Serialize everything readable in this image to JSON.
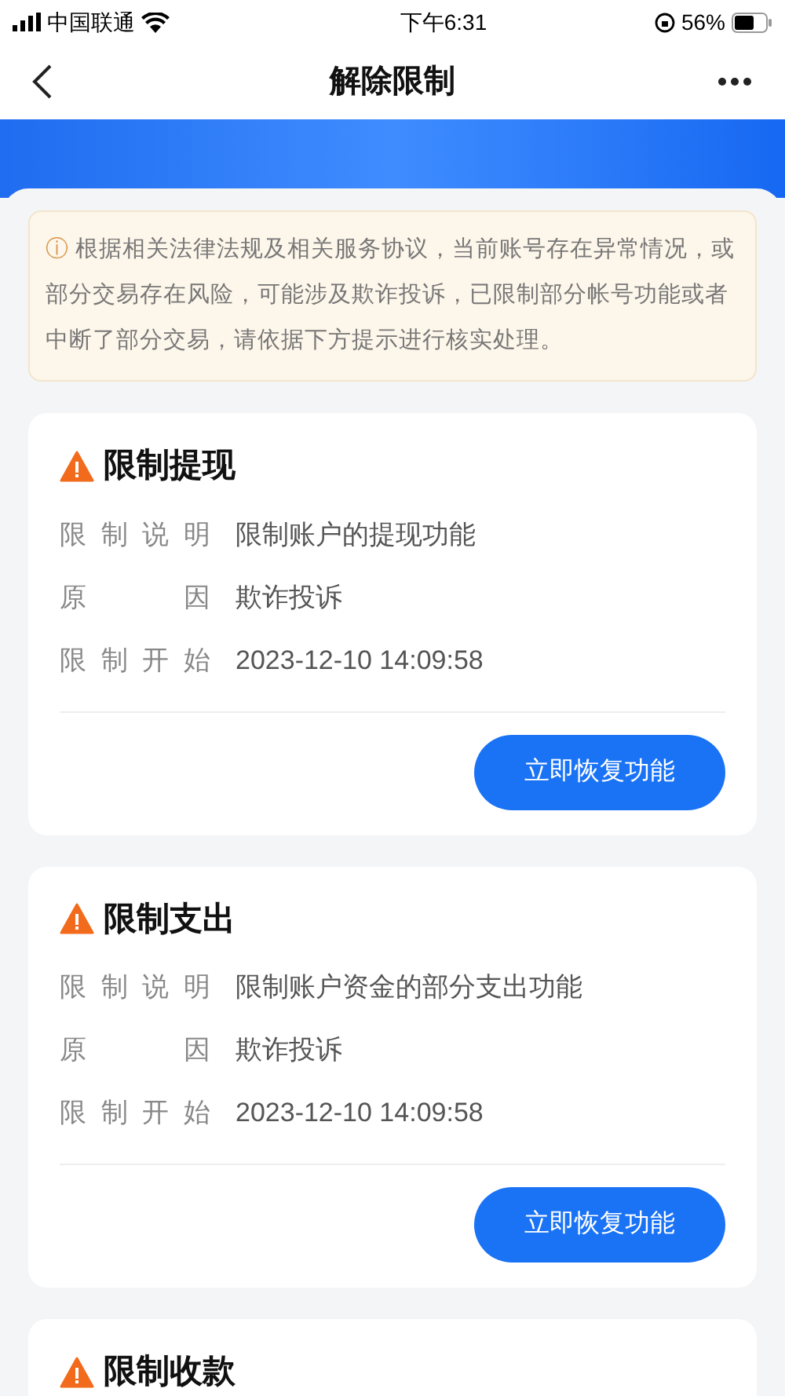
{
  "status_bar": {
    "carrier": "中国联通",
    "time": "下午6:31",
    "battery": "56%"
  },
  "nav": {
    "title": "解除限制"
  },
  "notice": {
    "icon": "ⓘ",
    "text": "根据相关法律法规及相关服务协议，当前账号存在异常情况，或部分交易存在风险，可能涉及欺诈投诉，已限制部分帐号功能或者中断了部分交易，请依据下方提示进行核实处理。"
  },
  "restrictions": [
    {
      "title": "限制提现",
      "rows": [
        {
          "label": "限制说明",
          "value": "限制账户的提现功能"
        },
        {
          "label": "原因",
          "value": "欺诈投诉"
        },
        {
          "label": "限制开始",
          "value": "2023-12-10 14:09:58"
        }
      ],
      "button": "立即恢复功能"
    },
    {
      "title": "限制支出",
      "rows": [
        {
          "label": "限制说明",
          "value": "限制账户资金的部分支出功能"
        },
        {
          "label": "原因",
          "value": "欺诈投诉"
        },
        {
          "label": "限制开始",
          "value": "2023-12-10 14:09:58"
        }
      ],
      "button": "立即恢复功能"
    },
    {
      "title": "限制收款"
    }
  ]
}
